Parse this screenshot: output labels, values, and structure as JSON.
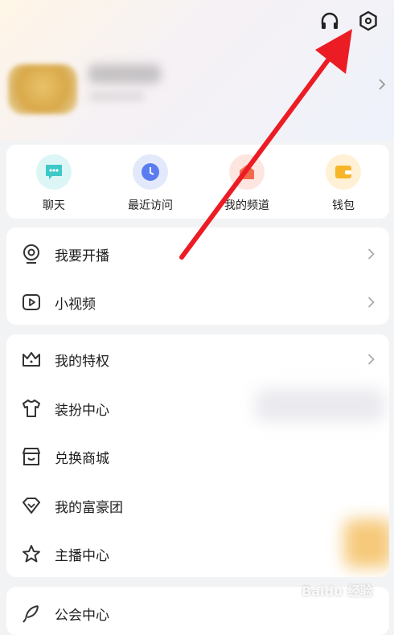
{
  "quick": [
    {
      "label": "聊天",
      "icon": "chat-icon",
      "bg": "#dcf6f6",
      "color": "#3ec8c8"
    },
    {
      "label": "最近访问",
      "icon": "clock-icon",
      "bg": "#e3e9fb",
      "color": "#5b7cf0"
    },
    {
      "label": "我的频道",
      "icon": "channel-icon",
      "bg": "#fde6e0",
      "color": "#f26a4d"
    },
    {
      "label": "钱包",
      "icon": "wallet-icon",
      "bg": "#fff1d6",
      "color": "#f7b52a"
    }
  ],
  "menu_group1": [
    {
      "label": "我要开播",
      "icon": "live-camera-icon",
      "chevron": true
    },
    {
      "label": "小视频",
      "icon": "video-icon",
      "chevron": true
    }
  ],
  "menu_group2": [
    {
      "label": "我的特权",
      "icon": "crown-icon",
      "chevron": true
    },
    {
      "label": "装扮中心",
      "icon": "tshirt-icon",
      "chevron": false
    },
    {
      "label": "兑换商城",
      "icon": "store-icon",
      "chevron": false
    },
    {
      "label": "我的富豪团",
      "icon": "diamond-icon",
      "chevron": false
    },
    {
      "label": "主播中心",
      "icon": "star-icon",
      "chevron": false
    }
  ],
  "menu_group3": [
    {
      "label": "公会中心",
      "icon": "feather-icon"
    }
  ],
  "watermark": "Baidu 经验",
  "colors": {
    "annotation_arrow": "#ec1c24"
  }
}
